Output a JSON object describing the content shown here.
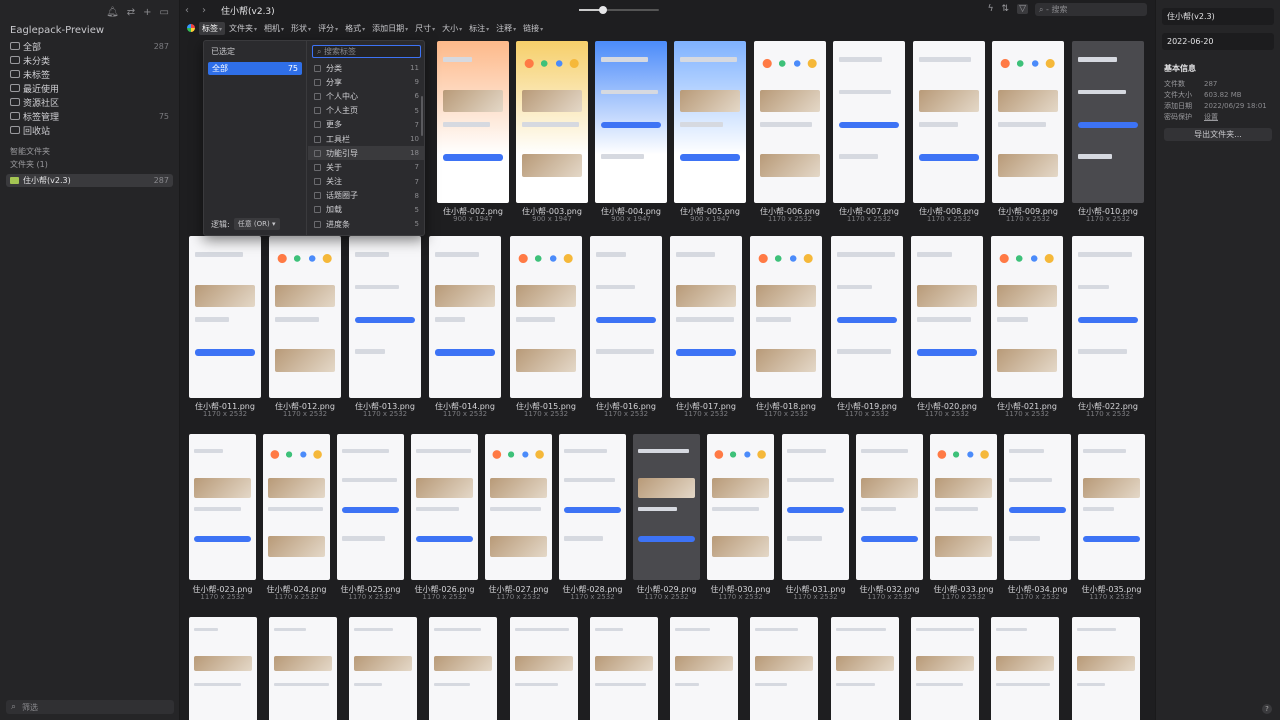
{
  "sidebar": {
    "library_name": "Eaglepack-Preview",
    "top_icons": [
      "bell-icon",
      "sync-icon",
      "add-icon",
      "layout-icon"
    ],
    "items": [
      {
        "label": "全部",
        "count": "287",
        "icon": "all-icon"
      },
      {
        "label": "未分类",
        "count": "",
        "icon": "unfiled-icon"
      },
      {
        "label": "未标签",
        "count": "",
        "icon": "untagged-icon"
      },
      {
        "label": "最近使用",
        "count": "",
        "icon": "recent-icon"
      },
      {
        "label": "资源社区",
        "count": "",
        "icon": "community-icon"
      },
      {
        "label": "标签管理",
        "count": "75",
        "icon": "tag-icon"
      },
      {
        "label": "回收站",
        "count": "",
        "icon": "trash-icon"
      }
    ],
    "smart_folders_label": "智能文件夹",
    "folders_label": "文件夹 (1)",
    "folder": {
      "label": "住小帮(v2.3)",
      "count": "287"
    },
    "filter_placeholder": "筛选"
  },
  "header": {
    "title": "住小帮(v2.3)",
    "search_placeholder": "搜索",
    "zoom_fraction": 0.3
  },
  "filterbar": [
    {
      "label": "标签",
      "active": true
    },
    {
      "label": "文件夹",
      "active": false
    },
    {
      "label": "相机",
      "active": false
    },
    {
      "label": "形状",
      "active": false
    },
    {
      "label": "评分",
      "active": false
    },
    {
      "label": "格式",
      "active": false
    },
    {
      "label": "添加日期",
      "active": false
    },
    {
      "label": "尺寸",
      "active": false
    },
    {
      "label": "大小",
      "active": false
    },
    {
      "label": "标注",
      "active": false
    },
    {
      "label": "注释",
      "active": false
    },
    {
      "label": "链接",
      "active": false
    }
  ],
  "tag_popup": {
    "selected_header": "已选定",
    "all_label": "全部",
    "all_count": "75",
    "logic_label": "逻辑:",
    "logic_value": "任意 (OR)",
    "search_placeholder": "搜索标签",
    "tags": [
      {
        "label": "分类",
        "count": "11"
      },
      {
        "label": "分享",
        "count": "9"
      },
      {
        "label": "个人中心",
        "count": "6"
      },
      {
        "label": "个人主页",
        "count": "5"
      },
      {
        "label": "更多",
        "count": "7"
      },
      {
        "label": "工具栏",
        "count": "10"
      },
      {
        "label": "功能引导",
        "count": "18"
      },
      {
        "label": "关于",
        "count": "7"
      },
      {
        "label": "关注",
        "count": "7"
      },
      {
        "label": "话题圈子",
        "count": "8"
      },
      {
        "label": "加载",
        "count": "5"
      },
      {
        "label": "进度条",
        "count": "5"
      }
    ]
  },
  "files": [
    {
      "name": "住小帮-002.png",
      "size": "900 x 1947"
    },
    {
      "name": "住小帮-003.png",
      "size": "900 x 1947"
    },
    {
      "name": "住小帮-004.png",
      "size": "900 x 1947"
    },
    {
      "name": "住小帮-005.png",
      "size": "900 x 1947"
    },
    {
      "name": "住小帮-006.png",
      "size": "1170 x 2532"
    },
    {
      "name": "住小帮-007.png",
      "size": "1170 x 2532"
    },
    {
      "name": "住小帮-008.png",
      "size": "1170 x 2532"
    },
    {
      "name": "住小帮-009.png",
      "size": "1170 x 2532"
    },
    {
      "name": "住小帮-010.png",
      "size": "1170 x 2532"
    },
    {
      "name": "住小帮-011.png",
      "size": "1170 x 2532"
    },
    {
      "name": "住小帮-012.png",
      "size": "1170 x 2532"
    },
    {
      "name": "住小帮-013.png",
      "size": "1170 x 2532"
    },
    {
      "name": "住小帮-014.png",
      "size": "1170 x 2532"
    },
    {
      "name": "住小帮-015.png",
      "size": "1170 x 2532"
    },
    {
      "name": "住小帮-016.png",
      "size": "1170 x 2532"
    },
    {
      "name": "住小帮-017.png",
      "size": "1170 x 2532"
    },
    {
      "name": "住小帮-018.png",
      "size": "1170 x 2532"
    },
    {
      "name": "住小帮-019.png",
      "size": "1170 x 2532"
    },
    {
      "name": "住小帮-020.png",
      "size": "1170 x 2532"
    },
    {
      "name": "住小帮-021.png",
      "size": "1170 x 2532"
    },
    {
      "name": "住小帮-022.png",
      "size": "1170 x 2532"
    },
    {
      "name": "住小帮-023.png",
      "size": "1170 x 2532"
    },
    {
      "name": "住小帮-024.png",
      "size": "1170 x 2532"
    },
    {
      "name": "住小帮-025.png",
      "size": "1170 x 2532"
    },
    {
      "name": "住小帮-026.png",
      "size": "1170 x 2532"
    },
    {
      "name": "住小帮-027.png",
      "size": "1170 x 2532"
    },
    {
      "name": "住小帮-028.png",
      "size": "1170 x 2532"
    },
    {
      "name": "住小帮-029.png",
      "size": "1170 x 2532"
    },
    {
      "name": "住小帮-030.png",
      "size": "1170 x 2532"
    },
    {
      "name": "住小帮-031.png",
      "size": "1170 x 2532"
    },
    {
      "name": "住小帮-032.png",
      "size": "1170 x 2532"
    },
    {
      "name": "住小帮-033.png",
      "size": "1170 x 2532"
    },
    {
      "name": "住小帮-034.png",
      "size": "1170 x 2532"
    },
    {
      "name": "住小帮-035.png",
      "size": "1170 x 2532"
    }
  ],
  "inspector": {
    "folder_name": "住小帮(v2.3)",
    "date": "2022-06-20",
    "section_title": "基本信息",
    "rows": [
      {
        "key": "文件数",
        "value": "287"
      },
      {
        "key": "文件大小",
        "value": "603.82 MB"
      },
      {
        "key": "添加日期",
        "value": "2022/06/29 18:01"
      },
      {
        "key": "密码保护",
        "value": "设置"
      }
    ],
    "export_label": "导出文件夹..."
  },
  "colors": {
    "accent": "#2f6fe8",
    "folder": "#a4c553",
    "background": "#1e1e20"
  }
}
